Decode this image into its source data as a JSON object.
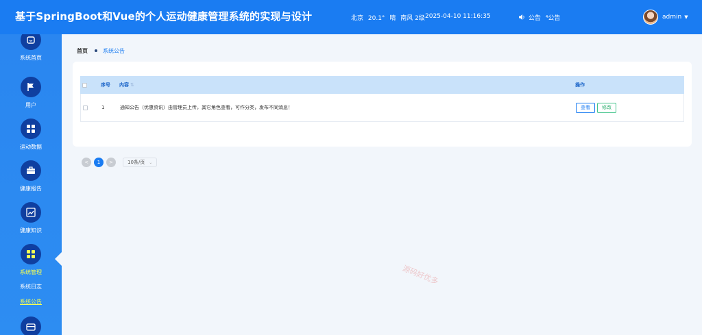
{
  "header": {
    "title": "基于SpringBoot和Vue的个人运动健康管理系统的实现与设计",
    "weather": {
      "city": "北京",
      "temp": "20.1°",
      "condition": "晴",
      "wind": "南风 2级"
    },
    "datetime": "2025-04-10 11:16:35",
    "notice_label": "公告",
    "notice_label2": "公告",
    "user": "admin"
  },
  "sidebar": {
    "items": [
      {
        "label": "系统首页",
        "icon": "home-icon"
      },
      {
        "label": "用户",
        "icon": "flag-icon"
      },
      {
        "label": "运动数据",
        "icon": "grid-icon"
      },
      {
        "label": "健康报告",
        "icon": "briefcase-icon"
      },
      {
        "label": "健康知识",
        "icon": "chart-icon"
      },
      {
        "label": "系统管理",
        "icon": "grid-icon"
      }
    ],
    "sub_items": [
      {
        "label": "系统日志"
      },
      {
        "label": "系统公告"
      }
    ],
    "bottom_icon": "wallet-icon"
  },
  "breadcrumb": {
    "home": "首页",
    "current": "系统公告"
  },
  "table": {
    "columns": {
      "no": "序号",
      "content": "内容",
      "op": "操作"
    },
    "rows": [
      {
        "no": "1",
        "content": "通知公告（优惠资讯）由管理员上传，其它角色查看，可作分类，发布不同消息！",
        "view": "查看",
        "edit": "修改"
      }
    ]
  },
  "pager": {
    "current": "1",
    "prev": "<",
    "next": ">",
    "page_size": "10条/页"
  },
  "watermark": "源码好优多",
  "colors": {
    "primary": "#1a7cf2",
    "sidebar_icon_bg": "#0f3fa0",
    "active": "#f5ff54",
    "header_row": "#c9e2fa",
    "edit": "#2fae6f"
  }
}
